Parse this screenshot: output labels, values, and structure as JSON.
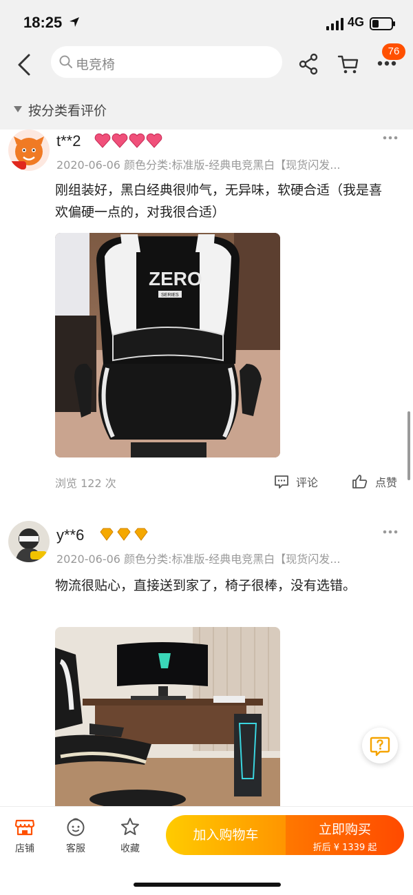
{
  "status_bar": {
    "time": "18:25",
    "network": "4G"
  },
  "header": {
    "search_text": "电竞椅",
    "cart_badge": "76"
  },
  "filter": {
    "label": "按分类看评价"
  },
  "reviews": [
    {
      "username": "t**2",
      "meta": "2020-06-06 颜色分类:标准版-经典电竞黑白【现货闪发...",
      "text": "刚组装好，黑白经典很帅气，无异味，软硬合适（我是喜欢偏硬一点的，对我很合适）",
      "photo_text_1": "ZERO",
      "photo_text_2": "SERIES",
      "views": "浏览 122 次",
      "comment_label": "评论",
      "like_label": "点赞"
    },
    {
      "username": "y**6",
      "meta": "2020-06-06 颜色分类:标准版-经典电竞黑白【现货闪发...",
      "text": "物流很贴心，直接送到家了，椅子很棒，没有选错。"
    }
  ],
  "bottom_bar": {
    "shop_label": "店铺",
    "service_label": "客服",
    "favorite_label": "收藏",
    "add_cart_label": "加入购物车",
    "buy_label": "立即购买",
    "buy_sub": "折后 ¥ 1339 起"
  },
  "colors": {
    "accent": "#ff5000",
    "cart_gradient_start": "#ffcb00",
    "buy_gradient_end": "#ff4a00",
    "level_pink": "#f0507a",
    "level_gold": "#f5a800"
  }
}
